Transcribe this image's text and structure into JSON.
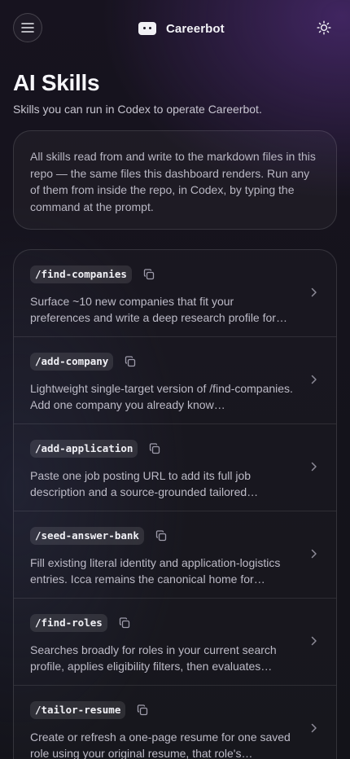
{
  "header": {
    "app_name": "Careerbot",
    "menu_icon": "hamburger-menu-icon",
    "logo_icon": "bot-face-icon",
    "theme_icon": "sun-icon"
  },
  "page": {
    "title": "AI Skills",
    "subtitle": "Skills you can run in Codex to operate Careerbot."
  },
  "info": {
    "text": "All skills read from and write to the markdown files in this repo — the same files this dashboard renders. Run any of them from inside the repo, in Codex, by typing the command at the prompt."
  },
  "skills": [
    {
      "command": "/find-companies",
      "description": "Surface ~10 new companies that fit your preferences and write a deep research profile for…"
    },
    {
      "command": "/add-company",
      "description": "Lightweight single-target version of /find-companies. Add one company you already know…"
    },
    {
      "command": "/add-application",
      "description": "Paste one job posting URL to add its full job description and a source-grounded tailored…"
    },
    {
      "command": "/seed-answer-bank",
      "description": "Fill existing literal identity and application-logistics entries. Icca remains the canonical home for…"
    },
    {
      "command": "/find-roles",
      "description": "Searches broadly for roles in your current search profile, applies eligibility filters, then evaluates…"
    },
    {
      "command": "/tailor-resume",
      "description": "Create or refresh a one-page resume for one saved role using your original resume, that role's…"
    }
  ],
  "icons": {
    "copy": "copy-icon",
    "chevron": "chevron-right-icon"
  },
  "colors": {
    "accent_glow": "#6a3aa0",
    "background": "#15131c",
    "text": "#ececf2"
  }
}
